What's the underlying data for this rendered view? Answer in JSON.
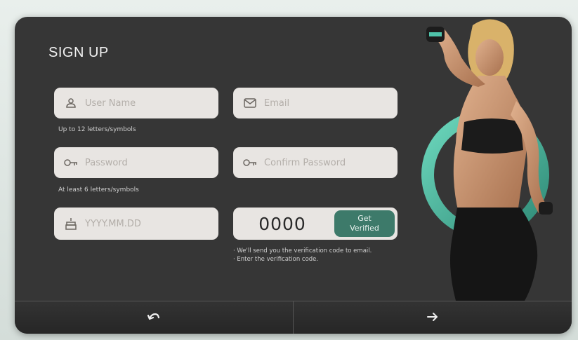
{
  "form": {
    "title": "SIGN UP",
    "username": {
      "placeholder": "User Name",
      "hint": "Up to 12 letters/symbols",
      "icon": "user-icon"
    },
    "email": {
      "placeholder": "Email",
      "icon": "mail-icon"
    },
    "password": {
      "placeholder": "Password",
      "hint": "At least 6 letters/symbols",
      "icon": "key-icon"
    },
    "confirm_password": {
      "placeholder": "Confirm Password",
      "icon": "key-icon"
    },
    "birthdate": {
      "placeholder": "YYYY.MM.DD",
      "icon": "cake-icon"
    },
    "verification": {
      "value": "0000",
      "button_line1": "Get",
      "button_line2": "Verified",
      "note1": "· We'll send you the verification code to email.",
      "note2": "· Enter the verification code."
    }
  },
  "footer": {
    "back_icon": "undo-arrow-icon",
    "next_icon": "right-arrow-icon"
  },
  "colors": {
    "panel": "#363636",
    "field": "#e8e5e2",
    "accent": "#3d7a6a",
    "ring": "#4fc3aa"
  }
}
